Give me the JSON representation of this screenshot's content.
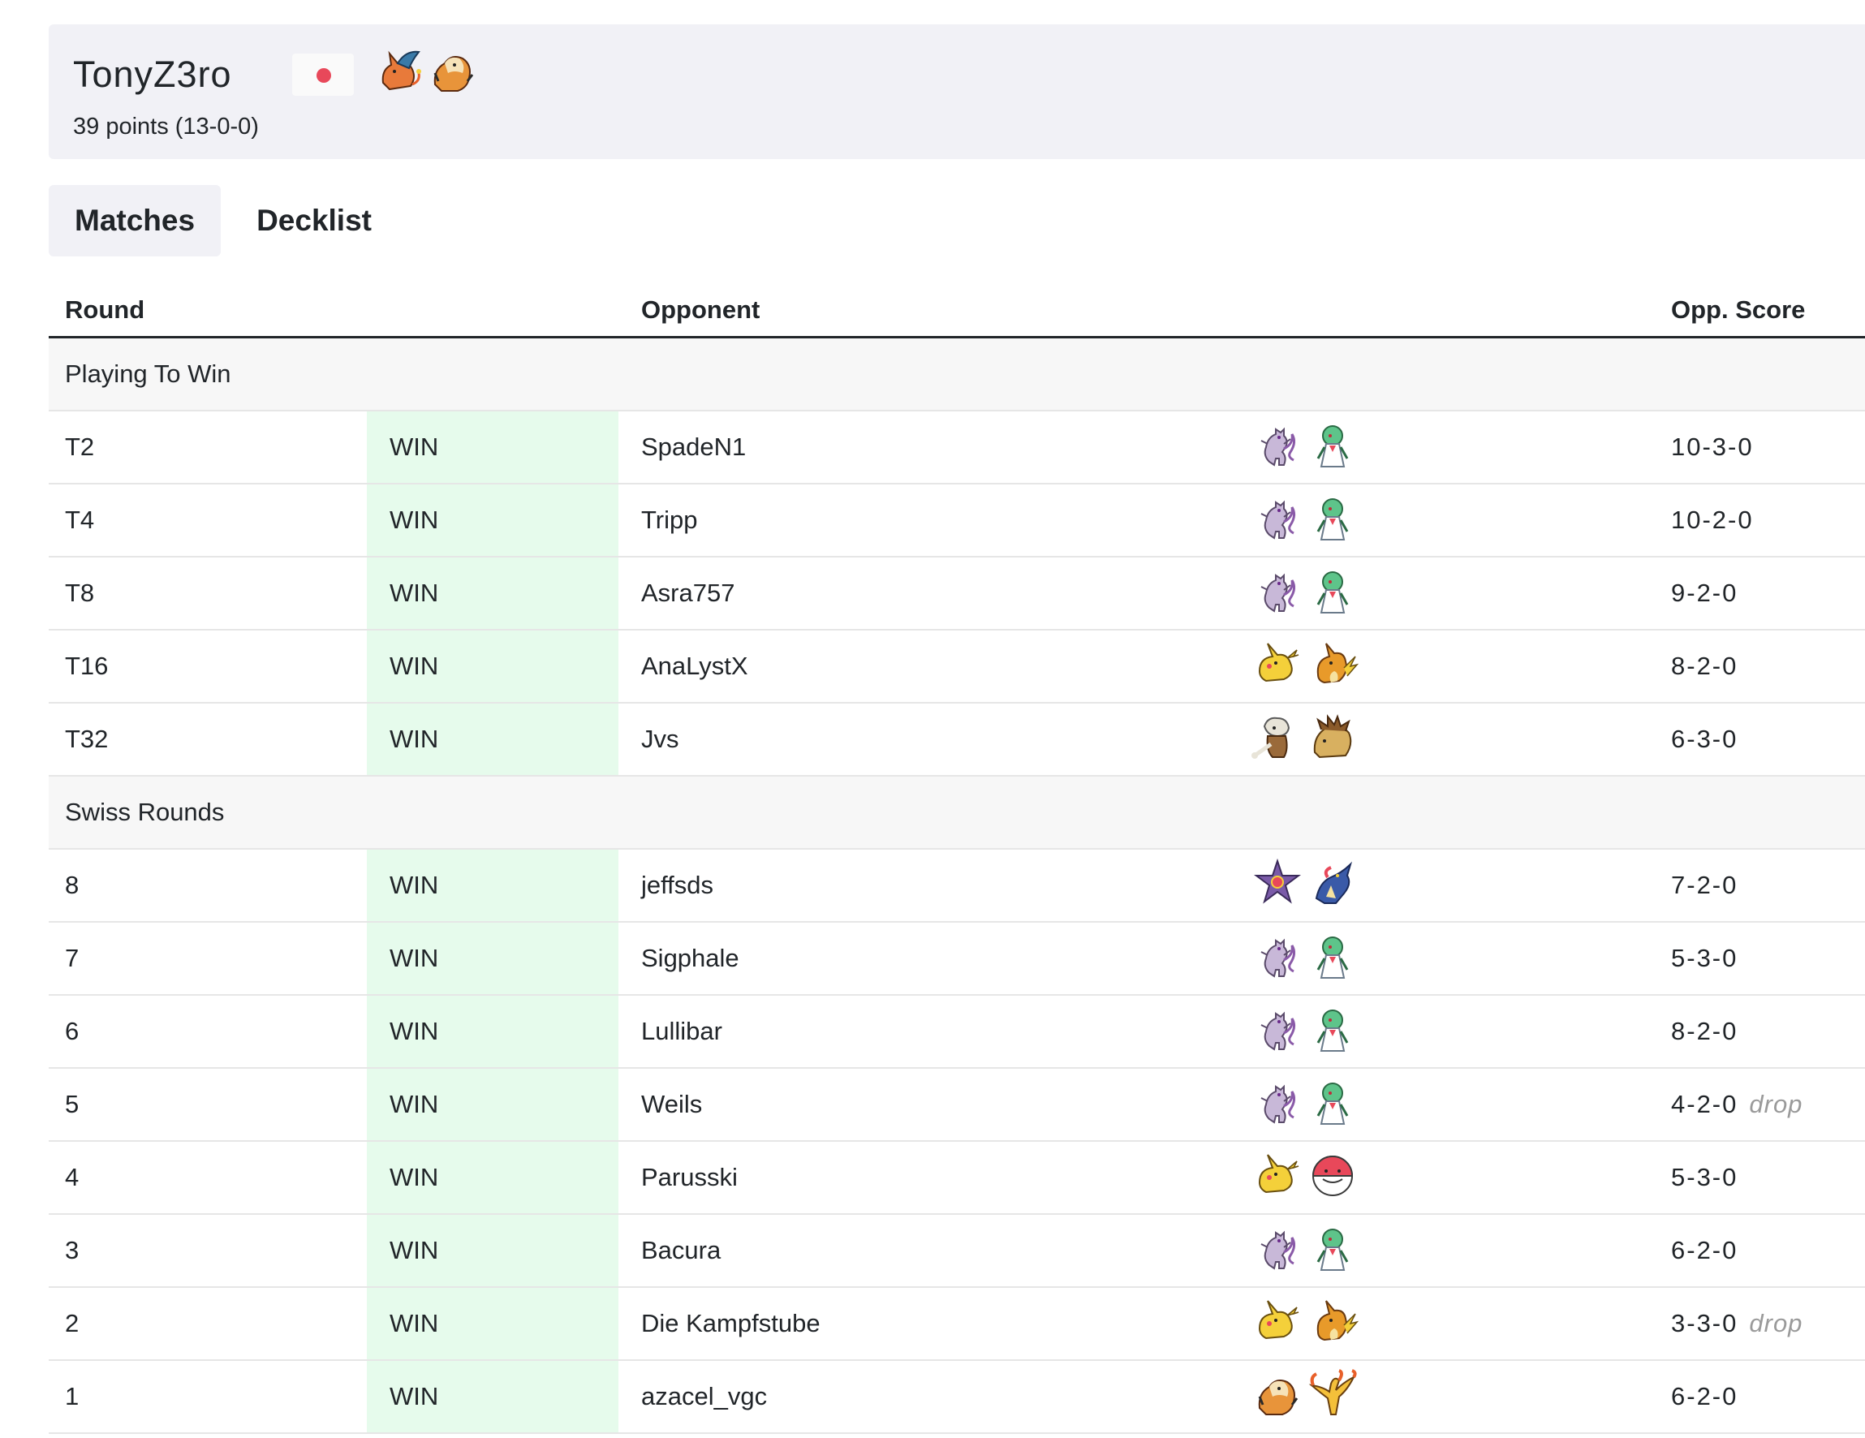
{
  "player": {
    "name": "TonyZ3ro",
    "points": "39 points (13-0-0)",
    "flag_color": "#e8485a",
    "deck_icons": [
      "charizard-icon",
      "arcanine-icon"
    ]
  },
  "tabs": [
    {
      "label": "Matches",
      "active": true
    },
    {
      "label": "Decklist",
      "active": false
    }
  ],
  "table": {
    "headers": {
      "round": "Round",
      "opponent": "Opponent",
      "opp_score": "Opp. Score"
    },
    "sections": [
      {
        "label": "Playing To Win",
        "rows": [
          {
            "round": "T2",
            "result": "WIN",
            "opponent": "SpadeN1",
            "deck": [
              "mewtwo-icon",
              "gardevoir-icon"
            ],
            "score": "10-3-0",
            "drop": ""
          },
          {
            "round": "T4",
            "result": "WIN",
            "opponent": "Tripp",
            "deck": [
              "mewtwo-icon",
              "gardevoir-icon"
            ],
            "score": "10-2-0",
            "drop": ""
          },
          {
            "round": "T8",
            "result": "WIN",
            "opponent": "Asra757",
            "deck": [
              "mewtwo-icon",
              "gardevoir-icon"
            ],
            "score": "9-2-0",
            "drop": ""
          },
          {
            "round": "T16",
            "result": "WIN",
            "opponent": "AnaLystX",
            "deck": [
              "pikachu-icon",
              "raichu-icon"
            ],
            "score": "8-2-0",
            "drop": ""
          },
          {
            "round": "T32",
            "result": "WIN",
            "opponent": "Jvs",
            "deck": [
              "marowak-icon",
              "sandslash-icon"
            ],
            "score": "6-3-0",
            "drop": ""
          }
        ]
      },
      {
        "label": "Swiss Rounds",
        "rows": [
          {
            "round": "8",
            "result": "WIN",
            "opponent": "jeffsds",
            "deck": [
              "starmie-icon",
              "greninja-icon"
            ],
            "score": "7-2-0",
            "drop": ""
          },
          {
            "round": "7",
            "result": "WIN",
            "opponent": "Sigphale",
            "deck": [
              "mewtwo-icon",
              "gardevoir-icon"
            ],
            "score": "5-3-0",
            "drop": ""
          },
          {
            "round": "6",
            "result": "WIN",
            "opponent": "Lullibar",
            "deck": [
              "mewtwo-icon",
              "gardevoir-icon"
            ],
            "score": "8-2-0",
            "drop": ""
          },
          {
            "round": "5",
            "result": "WIN",
            "opponent": "Weils",
            "deck": [
              "mewtwo-icon",
              "gardevoir-icon"
            ],
            "score": "4-2-0",
            "drop": "drop"
          },
          {
            "round": "4",
            "result": "WIN",
            "opponent": "Parusski",
            "deck": [
              "pikachu-icon",
              "electrode-icon"
            ],
            "score": "5-3-0",
            "drop": ""
          },
          {
            "round": "3",
            "result": "WIN",
            "opponent": "Bacura",
            "deck": [
              "mewtwo-icon",
              "gardevoir-icon"
            ],
            "score": "6-2-0",
            "drop": ""
          },
          {
            "round": "2",
            "result": "WIN",
            "opponent": "Die Kampfstube",
            "deck": [
              "pikachu-icon",
              "raichu-icon"
            ],
            "score": "3-3-0",
            "drop": "drop"
          },
          {
            "round": "1",
            "result": "WIN",
            "opponent": "azacel_vgc",
            "deck": [
              "arcanine-icon",
              "moltres-icon"
            ],
            "score": "6-2-0",
            "drop": ""
          }
        ]
      }
    ]
  },
  "colors": {
    "win_background": "#e6fbec",
    "header_background": "#f1f1f6",
    "section_background": "#f7f7f7",
    "drop_text": "#9a9a9a"
  }
}
